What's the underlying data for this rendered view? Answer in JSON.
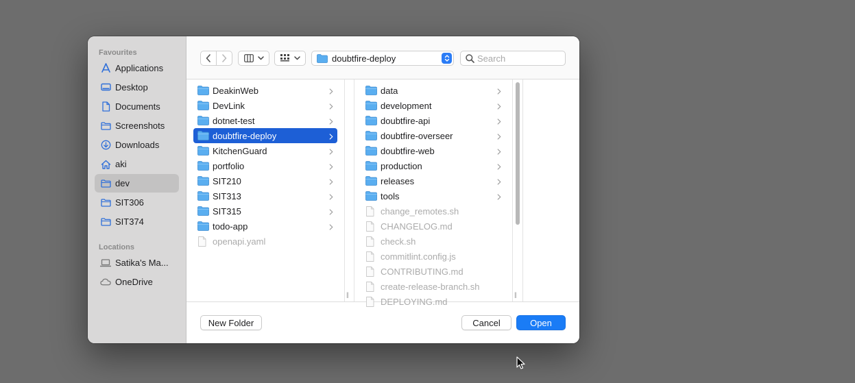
{
  "sidebar": {
    "favourites_heading": "Favourites",
    "favourites": [
      {
        "label": "Applications",
        "icon": "applications-icon"
      },
      {
        "label": "Desktop",
        "icon": "desktop-icon"
      },
      {
        "label": "Documents",
        "icon": "document-icon"
      },
      {
        "label": "Screenshots",
        "icon": "folder-icon"
      },
      {
        "label": "Downloads",
        "icon": "downloads-icon"
      },
      {
        "label": "aki",
        "icon": "home-icon"
      },
      {
        "label": "dev",
        "icon": "folder-icon",
        "selected": true
      },
      {
        "label": "SIT306",
        "icon": "folder-icon"
      },
      {
        "label": "SIT374",
        "icon": "folder-icon"
      }
    ],
    "locations_heading": "Locations",
    "locations": [
      {
        "label": "Satika's Ma...",
        "icon": "laptop-icon"
      },
      {
        "label": "OneDrive",
        "icon": "cloud-icon"
      }
    ]
  },
  "toolbar": {
    "current_folder": "doubtfire-deploy",
    "search_placeholder": "Search"
  },
  "columns": {
    "col1": [
      {
        "name": "DeakinWeb",
        "type": "folder"
      },
      {
        "name": "DevLink",
        "type": "folder"
      },
      {
        "name": "dotnet-test",
        "type": "folder"
      },
      {
        "name": "doubtfire-deploy",
        "type": "folder",
        "selected": true
      },
      {
        "name": "KitchenGuard",
        "type": "folder"
      },
      {
        "name": "portfolio",
        "type": "folder"
      },
      {
        "name": "SIT210",
        "type": "folder"
      },
      {
        "name": "SIT313",
        "type": "folder"
      },
      {
        "name": "SIT315",
        "type": "folder"
      },
      {
        "name": "todo-app",
        "type": "folder"
      },
      {
        "name": "openapi.yaml",
        "type": "file"
      }
    ],
    "col2": [
      {
        "name": "data",
        "type": "folder"
      },
      {
        "name": "development",
        "type": "folder"
      },
      {
        "name": "doubtfire-api",
        "type": "folder"
      },
      {
        "name": "doubtfire-overseer",
        "type": "folder"
      },
      {
        "name": "doubtfire-web",
        "type": "folder"
      },
      {
        "name": "production",
        "type": "folder"
      },
      {
        "name": "releases",
        "type": "folder"
      },
      {
        "name": "tools",
        "type": "folder"
      },
      {
        "name": "change_remotes.sh",
        "type": "file"
      },
      {
        "name": "CHANGELOG.md",
        "type": "file"
      },
      {
        "name": "check.sh",
        "type": "file"
      },
      {
        "name": "commitlint.config.js",
        "type": "file"
      },
      {
        "name": "CONTRIBUTING.md",
        "type": "file"
      },
      {
        "name": "create-release-branch.sh",
        "type": "file"
      },
      {
        "name": "DEPLOYING.md",
        "type": "file"
      }
    ]
  },
  "footer": {
    "new_folder_label": "New Folder",
    "cancel_label": "Cancel",
    "open_label": "Open"
  },
  "colors": {
    "accent": "#1a7cf6",
    "selection": "#1d5fd6",
    "folder": "#5aaef0"
  }
}
